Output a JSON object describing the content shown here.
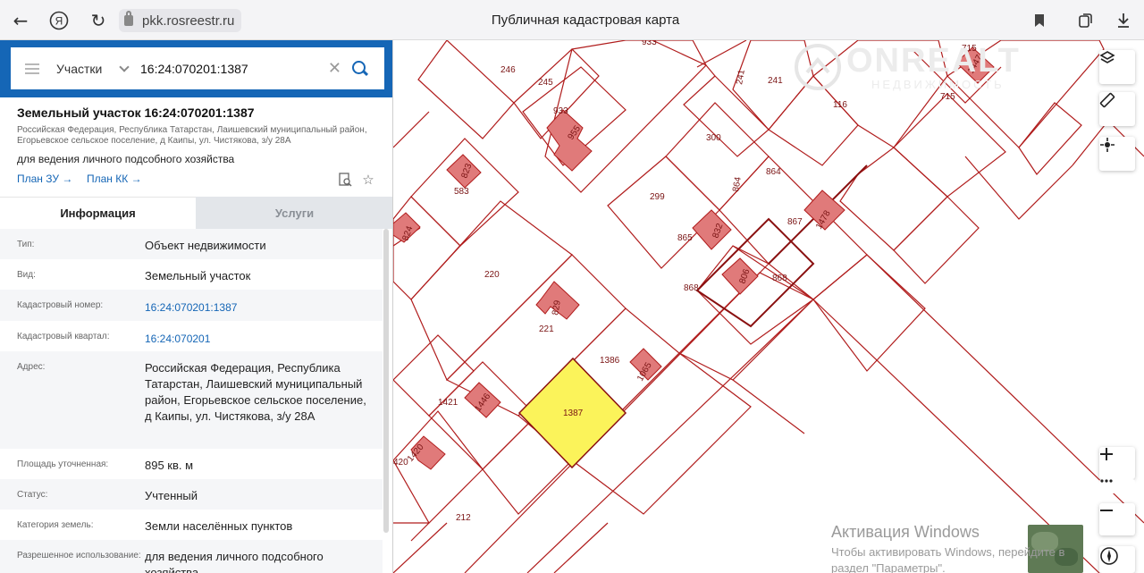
{
  "browser": {
    "url": "pkk.rosreestr.ru",
    "page_title": "Публичная кадастровая карта"
  },
  "search": {
    "type": "Участки",
    "value": "16:24:070201:1387"
  },
  "parcel": {
    "title": "Земельный участок 16:24:070201:1387",
    "address_line": "Российская Федерация, Республика Татарстан, Лаишевский муниципальный район, Егорьевское сельское поселение, д Каипы, ул. Чистякова, з/у 28А",
    "use": "для ведения личного подсобного хозяйства",
    "plan_zu": "План ЗУ →",
    "plan_kk": "План КК →"
  },
  "tabs": {
    "info": "Информация",
    "services": "Услуги"
  },
  "info_rows": [
    {
      "k": "Тип:",
      "v": "Объект недвижимости"
    },
    {
      "k": "Вид:",
      "v": "Земельный участок"
    },
    {
      "k": "Кадастровый номер:",
      "v": "16:24:070201:1387"
    },
    {
      "k": "Кадастровый квартал:",
      "v": "16:24:070201"
    },
    {
      "k": "Адрес:",
      "v": "Российская Федерация, Республика Татарстан, Лаишевский муниципальный район, Егорьевское сельское поселение, д Каипы, ул. Чистякова, з/у 28А"
    },
    {
      "k": "Площадь уточненная:",
      "v": "895 кв. м"
    },
    {
      "k": "Статус:",
      "v": "Учтенный"
    },
    {
      "k": "Категория земель:",
      "v": "Земли населённых пунктов"
    },
    {
      "k": "Разрешенное использование:",
      "v": "для ведения личного подсобного хозяйства"
    }
  ],
  "map": {
    "parcel_labels": [
      "933",
      "246",
      "245",
      "933",
      "241",
      "241",
      "715",
      "1447",
      "715",
      "116",
      "300",
      "864",
      "864",
      "299",
      "867",
      "1478",
      "865",
      "832",
      "868",
      "806",
      "868",
      "583",
      "823",
      "824",
      "220",
      "221",
      "829",
      "1386",
      "1065",
      "1421",
      "1446",
      "1387",
      "1420",
      "420",
      "212",
      "955"
    ],
    "selected_parcel": "1387",
    "selected_color": "#fbf35a",
    "boundary_color": "#b01c1c",
    "building_color": "#e07a7a"
  },
  "watermark": {
    "brand": "ONREALT",
    "brand_sub": "НЕДВИЖИМОСТЬ",
    "activation_title": "Активация Windows",
    "activation_line1": "Чтобы активировать Windows, перейдите в",
    "activation_line2": "раздел \"Параметры\"."
  }
}
